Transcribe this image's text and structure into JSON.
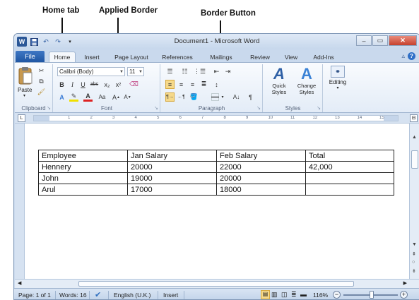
{
  "annotations": {
    "home_tab": "Home tab",
    "applied_border": "Applied Border",
    "border_button": "Border Button"
  },
  "window": {
    "title": "Document1 - Microsoft Word",
    "qat_icons": [
      "word-logo-icon",
      "save-icon",
      "undo-icon",
      "redo-icon"
    ]
  },
  "tabs": {
    "file": "File",
    "items": [
      "Home",
      "Insert",
      "Page Layout",
      "References",
      "Mailings",
      "Review",
      "View",
      "Add-Ins"
    ],
    "active": "Home"
  },
  "ribbon": {
    "clipboard": {
      "paste": "Paste",
      "label": "Clipboard"
    },
    "font": {
      "font_name": "Calibri (Body)",
      "font_size": "11",
      "label": "Font"
    },
    "paragraph": {
      "label": "Paragraph"
    },
    "styles": {
      "quick": "Quick\nStyles",
      "change": "Change\nStyles",
      "label": "Styles"
    },
    "editing": {
      "label": "Editing"
    }
  },
  "ruler": {
    "numbers": [
      "1",
      "2",
      "3",
      "4",
      "5",
      "6",
      "7",
      "8",
      "9",
      "10",
      "11",
      "12",
      "13",
      "14",
      "15"
    ]
  },
  "table": {
    "rows": [
      [
        "Employee",
        "Jan Salary",
        "Feb Salary",
        "Total"
      ],
      [
        "Hennery",
        "20000",
        "22000",
        "42,000"
      ],
      [
        "John",
        "19000",
        "20000",
        ""
      ],
      [
        "Arul",
        "17000",
        "18000",
        ""
      ]
    ]
  },
  "statusbar": {
    "page": "Page: 1 of 1",
    "words": "Words: 16",
    "language": "English (U.K.)",
    "mode": "Insert",
    "zoom": "116%",
    "zoom_percent": 116
  },
  "colors": {
    "file_tab": "#2b5797",
    "window_frame": "#c9d9ed",
    "close_button": "#c5412d"
  }
}
